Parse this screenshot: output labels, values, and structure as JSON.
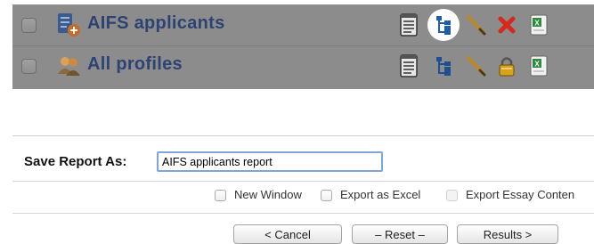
{
  "profiles": [
    {
      "label": "AIFS applicants",
      "icon": "report-user-icon",
      "third_action_icon": "delete-icon"
    },
    {
      "label": "All profiles",
      "icon": "users-group-icon",
      "third_action_icon": "lock-icon"
    }
  ],
  "row_actions": [
    "notepad-icon",
    "hierarchy-icon",
    "edit-pencil-icon",
    "delete-or-lock-icon",
    "excel-icon"
  ],
  "save_form": {
    "label": "Save Report As:",
    "value": "AIFS applicants report"
  },
  "options": {
    "new_window": "New Window",
    "export_excel": "Export as Excel",
    "export_essay": "Export Essay Conten"
  },
  "buttons": {
    "cancel": "< Cancel",
    "reset": "– Reset –",
    "results": "Results >"
  },
  "colors": {
    "list_background": "#8c8c8c",
    "label_text": "#2c4374",
    "input_border": "#7ea6d6"
  }
}
